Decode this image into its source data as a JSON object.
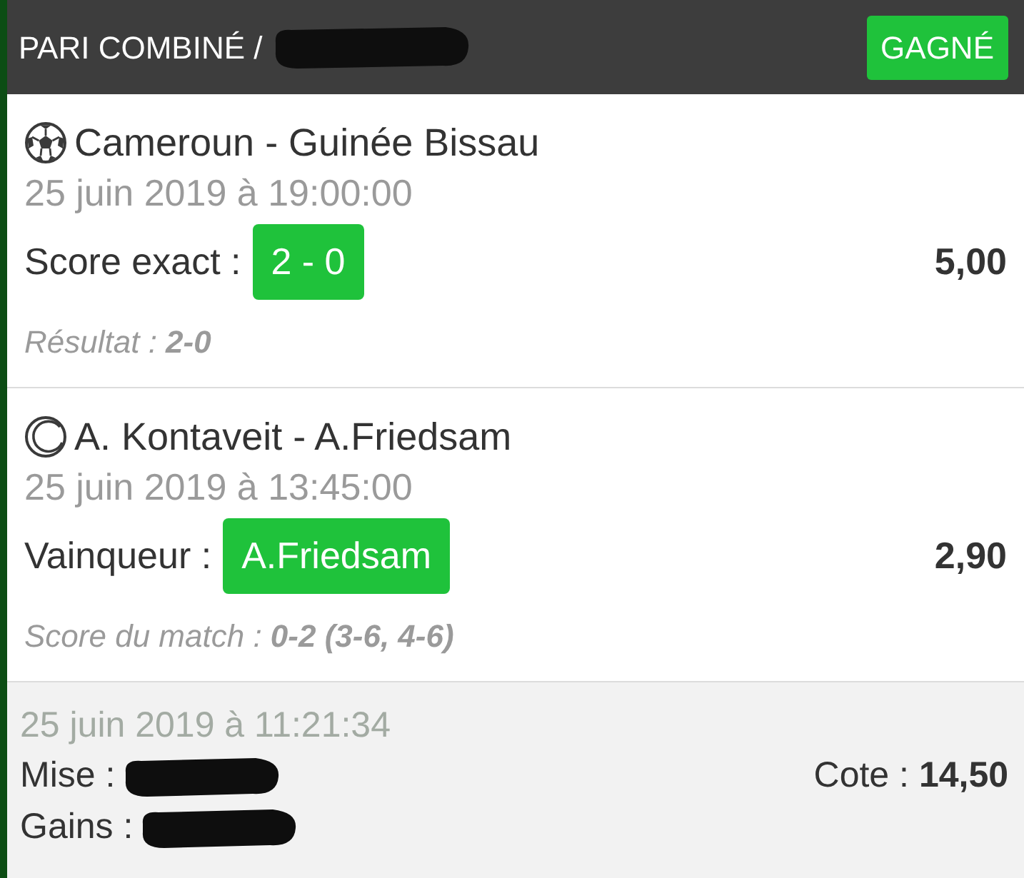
{
  "header": {
    "title": "PARI COMBINÉ /",
    "title_redacted": true,
    "status": {
      "label": "GAGNÉ",
      "kind": "won"
    }
  },
  "selections": [
    {
      "kind": "football",
      "match": "Cameroun - Guinée Bissau",
      "date": "25 juin 2019 à 19:00:00",
      "market": "Score exact :",
      "pick": "2 - 0",
      "won": true,
      "odds": "5,00",
      "result": "Résultat : **2-0**"
    },
    {
      "kind": "tennis",
      "match": "A. Kontaveit - A.Friedsam",
      "date": "25 juin 2019 à 13:45:00",
      "market": "Vainqueur :",
      "pick": "A.Friedsam",
      "won": true,
      "odds": "2,90",
      "result": "Score du match : **0-2 (3-6, 4-6)**"
    }
  ],
  "summary": {
    "date": "25 juin 2019 à 11:21:34",
    "stake": {
      "label": "Mise :",
      "redacted": true
    },
    "winnings": {
      "label": "Gains :",
      "redacted": true
    },
    "odds": "Cote : **14,50**"
  }
}
